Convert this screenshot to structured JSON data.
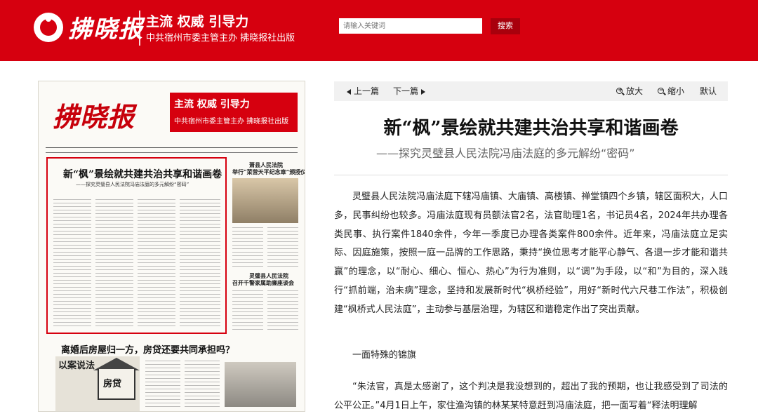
{
  "header": {
    "logo_text": "拂晓报",
    "slogan": "主流  权威  引导力",
    "slogan_sub": "中共宿州市委主管主办   拂晓报社出版",
    "search": {
      "placeholder": "请输入关键词",
      "button_label": "搜索"
    }
  },
  "paper_thumb": {
    "masthead": "拂晓报",
    "red_title": "主流  权威  引导力",
    "red_sub": "中共宿州市委主管主办   拂晓报社出版",
    "main_article_title": "新“枫”景绘就共建共治共享和谐画卷",
    "main_article_sub": "——探究灵璧县人民法院冯庙法庭的多元解纷“密码”",
    "side_title_1": "萧县人民法院",
    "side_title_2": "举行“菜营天平纪念章”颁授仪式",
    "side_title_3": "灵璧县人民法院",
    "side_title_4": "召开千警家属助廉座谈会",
    "second_article_title": "离婚后房屋归一方，房贷还要共同承担吗？",
    "cartoon_label": "以案说法",
    "house_label": "房贷"
  },
  "article_nav": {
    "prev_label": "上一篇",
    "next_label": "下一篇",
    "zoom_in_label": "放大",
    "zoom_out_label": "缩小",
    "default_label": "默认"
  },
  "article": {
    "title": "新“枫”景绘就共建共治共享和谐画卷",
    "subtitle": "——探究灵璧县人民法院冯庙法庭的多元解纷“密码”",
    "paragraphs": [
      "灵璧县人民法院冯庙法庭下辖冯庙镇、大庙镇、高楼镇、禅堂镇四个乡镇，辖区面积大，人口多，民事纠纷也较多。冯庙法庭现有员额法官2名，法官助理1名，书记员4名，2024年共办理各类民事、执行案件1840余件，今年一季度已办理各类案件800余件。近年来，冯庙法庭立足实际、因庭施策，按照一庭一品牌的工作思路，秉持“换位思考才能平心静气、各退一步才能和谐共赢”的理念，以“耐心、细心、恒心、热心”为行为准则，以“调”为手段，以“和”为目的，深入践行“抓前端，治未病”理念，坚持和发展新时代“枫桥经验”，用好“新时代六尺巷工作法”，积极创建“枫桥式人民法庭”，主动参与基层治理，为辖区和谐稳定作出了突出贡献。",
      "一面特殊的锦旗",
      "“朱法官，真是太感谢了，这个判决是我没想到的，超出了我的预期，也让我感受到了司法的公平公正。”4月1日上午，家住渔沟镇的林某某特意赶到冯庙法庭，把一面写着“释法明理解"
    ]
  }
}
